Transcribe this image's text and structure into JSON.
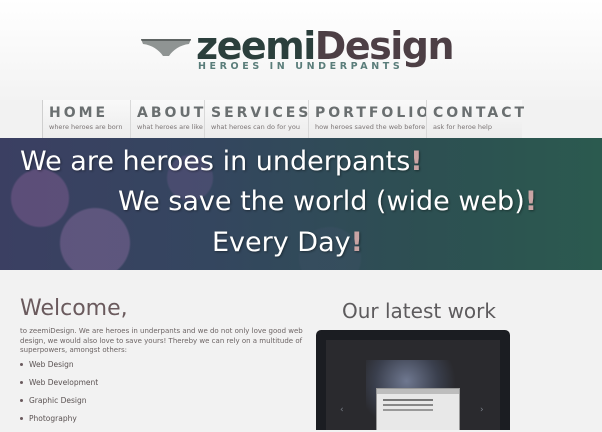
{
  "header": {
    "logo_part1": "zeemi",
    "logo_part2": "Design",
    "tagline": "HEROES IN UNDERPANTS"
  },
  "nav": [
    {
      "title": "HOME",
      "sub": "where heroes are born"
    },
    {
      "title": "ABOUT",
      "sub": "what heroes are like"
    },
    {
      "title": "SERVICES",
      "sub": "what heroes can do for you"
    },
    {
      "title": "PORTFOLIO",
      "sub": "how heroes saved the web before"
    },
    {
      "title": "CONTACT",
      "sub": "ask for heroe help"
    }
  ],
  "banner": {
    "line1": "We are heroes in underpants",
    "line2": "We save the world (wide web)",
    "line3": "Every Day",
    "excl": "!"
  },
  "welcome": {
    "title": "Welcome,",
    "text": "to zeemiDesign. We are heroes in underpants and we do not only love good web design, we would also love to save yours! Thereby we can rely on a multitude of superpowers, amongst others:",
    "services": [
      "Web Design",
      "Web Development",
      "Graphic Design",
      "Photography"
    ]
  },
  "latest": {
    "title": "Our latest work"
  },
  "colors": {
    "logo": "#2b3f3c",
    "banner_left": "#3b3f62",
    "banner_right": "#2b5a4f",
    "accent": "#c9a4a4"
  },
  "icons": [
    "underpants-logo-icon",
    "carousel-prev-icon",
    "carousel-next-icon"
  ]
}
